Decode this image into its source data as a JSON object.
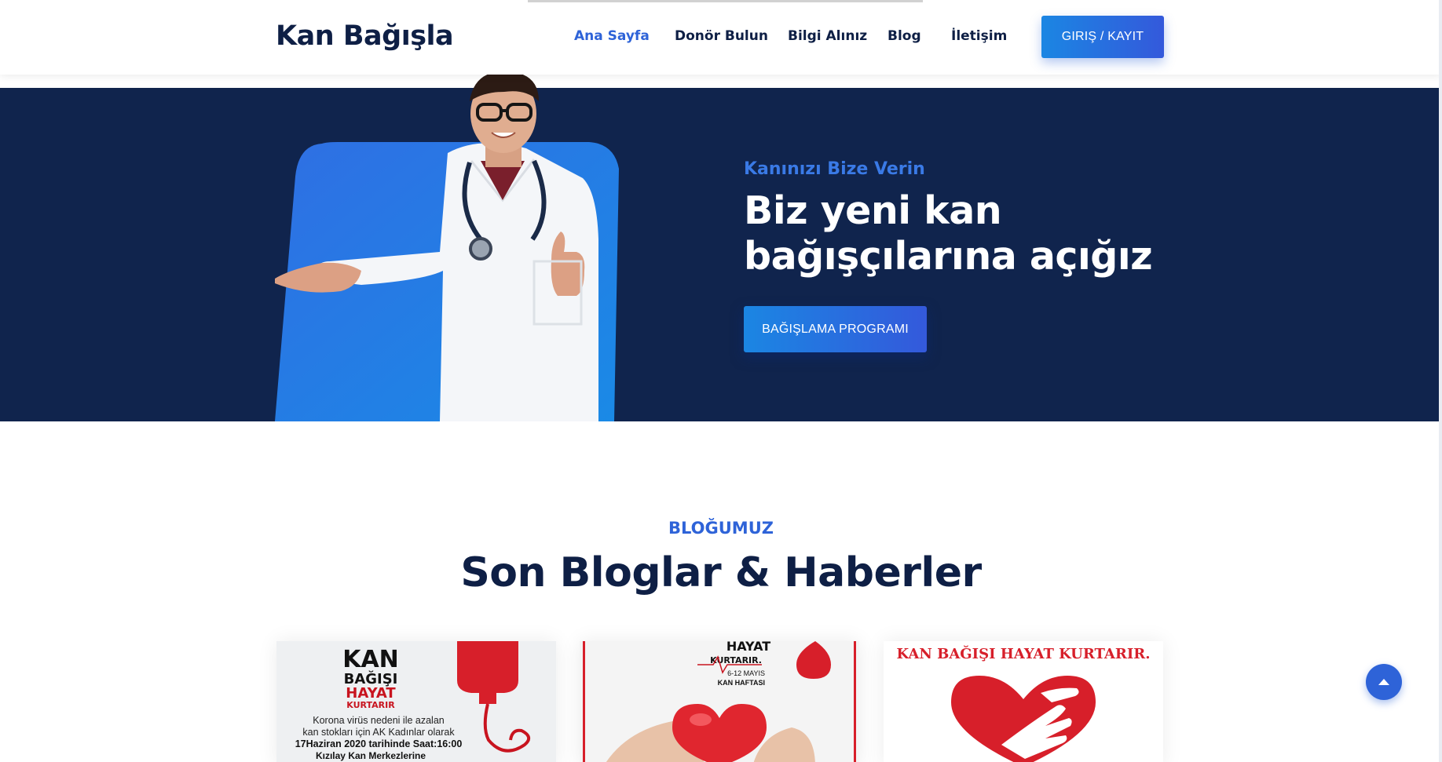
{
  "header": {
    "logo": "Kan Bağışla",
    "nav": [
      {
        "label": "Ana Sayfa",
        "active": true
      },
      {
        "label": "Donör Bulun",
        "active": false
      },
      {
        "label": "Bilgi Alınız",
        "active": false
      },
      {
        "label": "Blog",
        "active": false
      },
      {
        "label": "İletişim",
        "active": false
      }
    ],
    "login_button": "GIRIŞ / KAYIT"
  },
  "hero": {
    "kicker": "Kanınızı Bize Verin",
    "title": "Biz yeni kan bağışçılarına açığız",
    "button": "BAĞIŞLAMA PROGRAMI",
    "image_alt": "doctor-image"
  },
  "blog": {
    "kicker": "BLOĞUMUZ",
    "title": "Son Bloglar & Haberler",
    "cards": [
      {
        "lines": [
          "KAN",
          "BAĞIŞI",
          "HAYAT",
          "KURTARIR",
          "Korona virüs nedeni ile azalan",
          "kan stokları için AK Kadınlar olarak",
          "17Haziran 2020 tarihinde Saat:16:00",
          "Kızılay Kan Merkezlerine"
        ]
      },
      {
        "lines": [
          "HAYAT",
          "KURTARIR.",
          "6-12 MAYIS",
          "KAN HAFTASI"
        ]
      },
      {
        "lines": [
          "KAN BAĞIŞI HAYAT KURTARIR."
        ]
      }
    ]
  },
  "colors": {
    "brand_dark": "#0e1f45",
    "accent_blue": "#2e63d8",
    "hero_bg": "#10244d",
    "blood_red": "#d71f2a"
  },
  "icons": {
    "scroll_top": "caret-up-icon"
  }
}
